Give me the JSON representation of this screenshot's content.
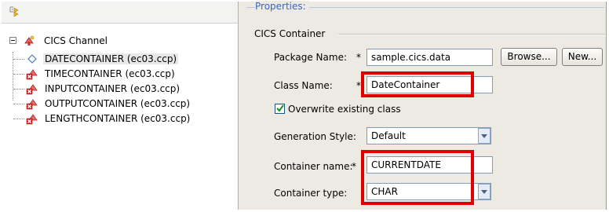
{
  "tree": {
    "root_label": "CICS Channel",
    "items": [
      {
        "label": "DATECONTAINER (ec03.ccp)",
        "icon": "diamond-icon",
        "selected": true
      },
      {
        "label": "TIMECONTAINER (ec03.ccp)",
        "icon": "container-error-icon"
      },
      {
        "label": "INPUTCONTAINER (ec03.ccp)",
        "icon": "container-error-icon"
      },
      {
        "label": "OUTPUTCONTAINER (ec03.ccp)",
        "icon": "container-error-icon"
      },
      {
        "label": "LENGTHCONTAINER (ec03.ccp)",
        "icon": "container-error-icon"
      }
    ]
  },
  "properties": {
    "header": "Properties:",
    "group_title": "CICS Container",
    "package_label": "Package Name:",
    "package_value": "sample.cics.data",
    "browse_label": "Browse...",
    "new_label": "New...",
    "class_label": "Class Name:",
    "class_value": "DateContainer",
    "overwrite_label": "Overwrite existing class",
    "overwrite_checked": true,
    "generation_label": "Generation Style:",
    "generation_value": "Default",
    "container_name_label": "Container name:",
    "container_name_value": "CURRENTDATE",
    "container_type_label": "Container type:",
    "container_type_value": "CHAR",
    "required_marker": "*"
  },
  "colors": {
    "highlight": "#e00000",
    "header_text": "#3c67b9",
    "pane_background": "#eceae3"
  }
}
